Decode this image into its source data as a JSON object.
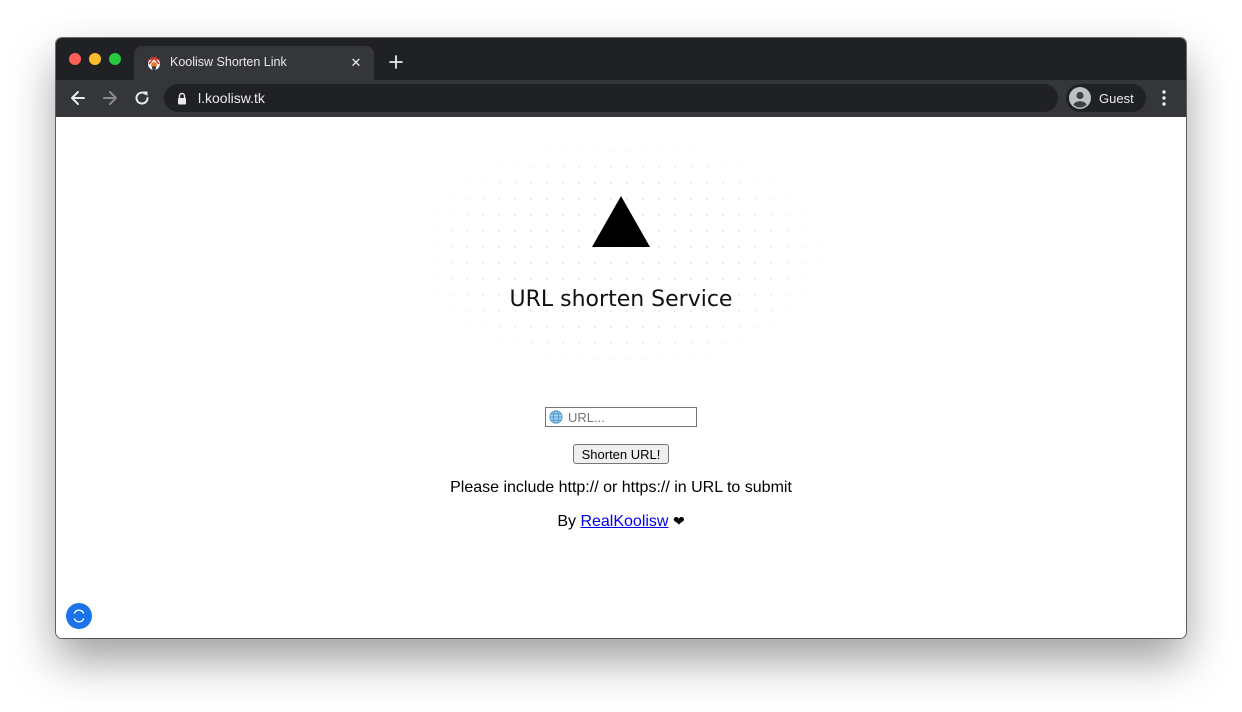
{
  "browser": {
    "tab": {
      "title": "Koolisw Shorten Link",
      "close_label": "✕",
      "favicon": "koolisw-favicon"
    },
    "new_tab_icon": "plus-icon",
    "toolbar": {
      "back_icon": "back-arrow-icon",
      "forward_icon": "forward-arrow-icon",
      "reload_icon": "reload-icon"
    },
    "address_bar": {
      "url": "l.koolisw.tk",
      "security_icon": "lock-icon"
    },
    "profile": {
      "label": "Guest",
      "icon": "avatar-icon"
    },
    "menu_icon": "kebab-menu-icon",
    "colors": {
      "tabstrip": "#202124",
      "active_tab": "#35363a",
      "omnibox": "#202124"
    }
  },
  "page": {
    "logo_icon": "triangle-logo-icon",
    "title": "URL shorten Service",
    "form": {
      "input_placeholder": "URL...",
      "input_icon": "globe-icon",
      "submit_label": "Shorten URL!"
    },
    "hint": "Please include http:// or https:// in URL to submit",
    "byline": {
      "prefix": "By",
      "author": "RealKoolisw",
      "heart": "❤"
    },
    "fab_icon": "refresh-fab-icon",
    "colors": {
      "link": "#0000ee",
      "fab": "#1a73e8"
    }
  }
}
